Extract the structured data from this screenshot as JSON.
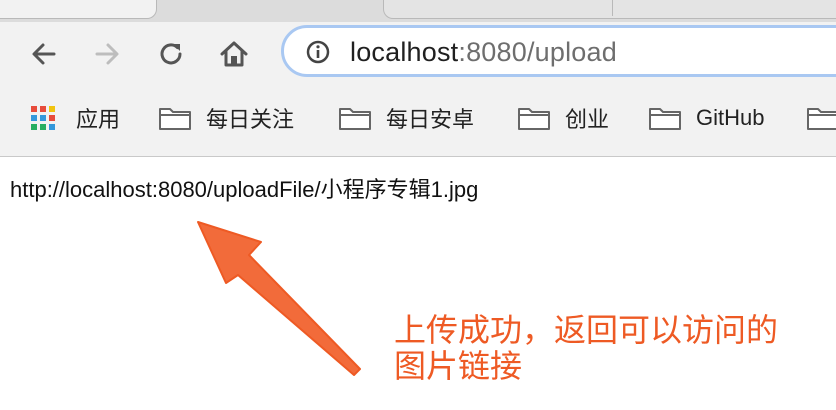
{
  "browser": {
    "address_bar": {
      "host": "localhost",
      "rest": ":8080/upload"
    },
    "bookmarks": [
      {
        "label": "应用",
        "icon": "apps-grid-icon"
      },
      {
        "label": "每日关注",
        "icon": "folder-icon"
      },
      {
        "label": "每日安卓",
        "icon": "folder-icon"
      },
      {
        "label": "创业",
        "icon": "folder-icon"
      },
      {
        "label": "GitHub",
        "icon": "folder-icon"
      },
      {
        "label": "",
        "icon": "folder-icon"
      }
    ]
  },
  "page": {
    "returned_url": "http://localhost:8080/uploadFile/小程序专辑1.jpg"
  },
  "annotation": {
    "line1": "上传成功，返回可以访问的",
    "line2": "图片链接",
    "color": "#ee5a24"
  }
}
